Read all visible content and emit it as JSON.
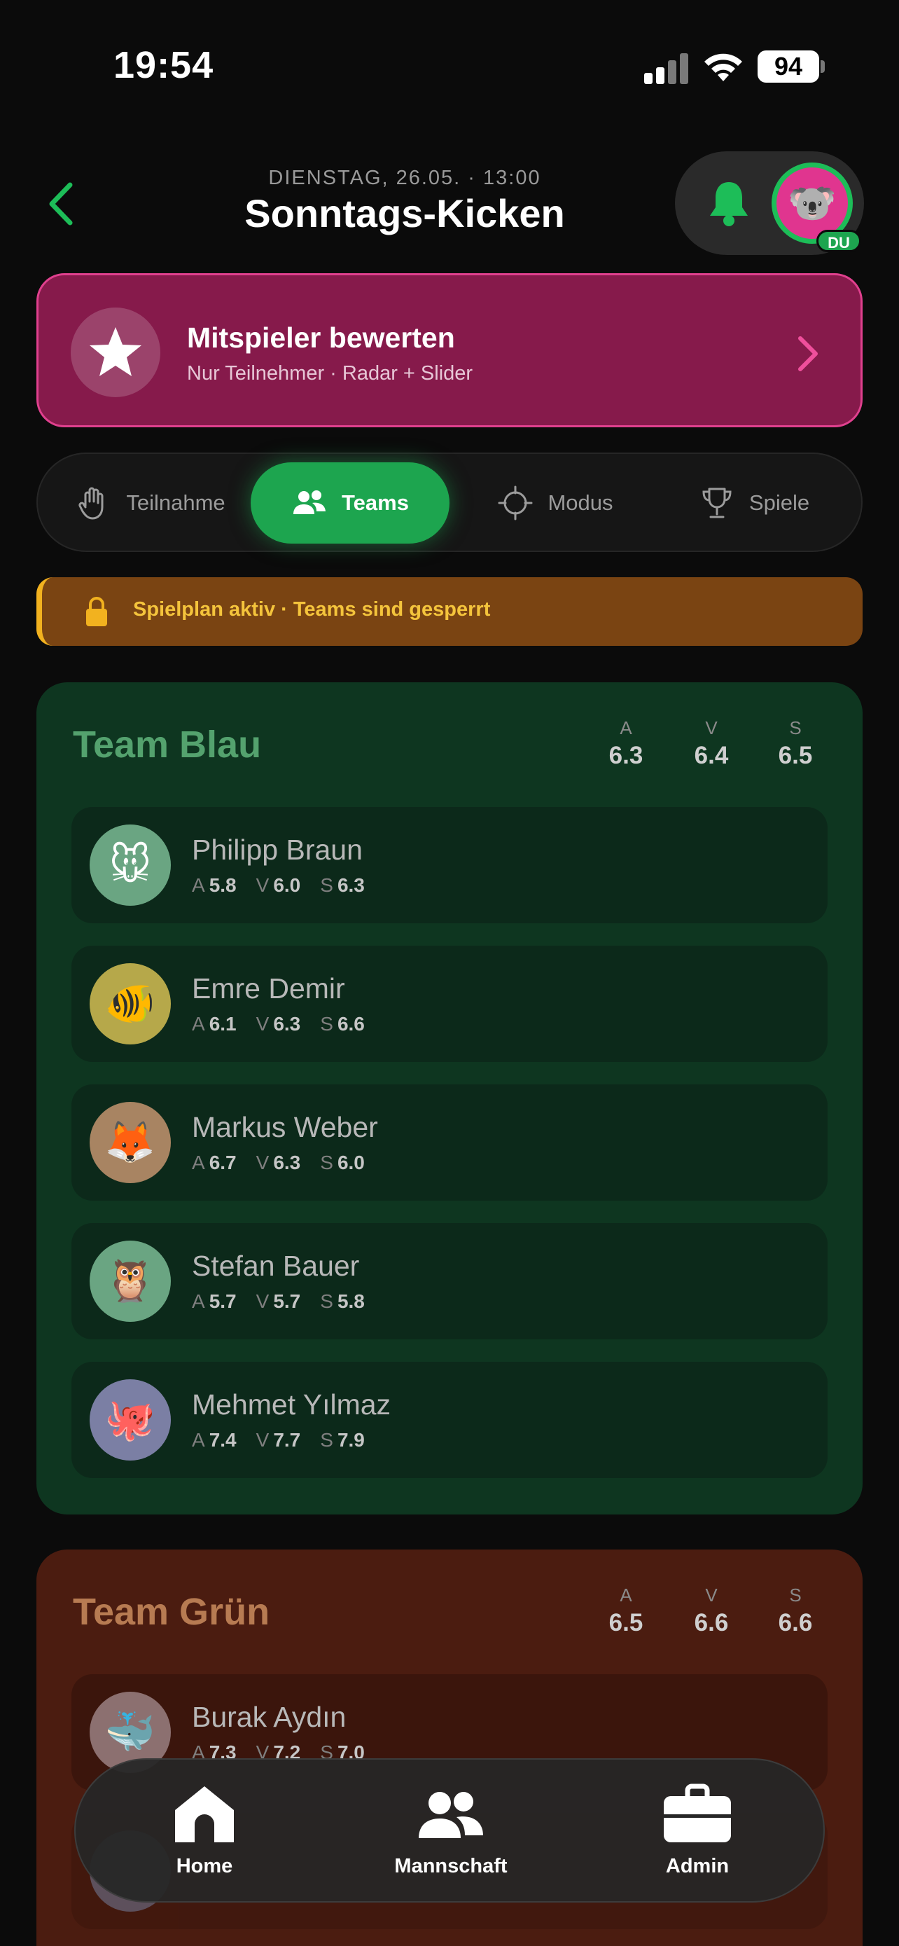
{
  "status_bar": {
    "time": "19:54",
    "battery": "94"
  },
  "header": {
    "datetime": "DIENSTAG, 26.05. · 13:00",
    "title": "Sonntags-Kicken",
    "avatar_emoji": "🐨",
    "avatar_badge": "DU"
  },
  "rating_banner": {
    "title": "Mitspieler bewerten",
    "subtitle": "Nur Teilnehmer · Radar + Slider"
  },
  "tabs": [
    {
      "label": "Teilnahme",
      "icon": "hand-icon",
      "active": false
    },
    {
      "label": "Teams",
      "icon": "users-icon",
      "active": true
    },
    {
      "label": "Modus",
      "icon": "crosshair-icon",
      "active": false
    },
    {
      "label": "Spiele",
      "icon": "trophy-icon",
      "active": false
    }
  ],
  "lock_banner": {
    "text": "Spielplan aktiv · Teams sind gesperrt"
  },
  "stat_keys": {
    "a": "A",
    "v": "V",
    "s": "S"
  },
  "teams": [
    {
      "name": "Team Blau",
      "stats": {
        "a": "6.3",
        "v": "6.4",
        "s": "6.5"
      },
      "players": [
        {
          "name": "Philipp Braun",
          "emoji": "🐭",
          "bg": "#6aa582",
          "a": "5.8",
          "v": "6.0",
          "s": "6.3"
        },
        {
          "name": "Emre Demir",
          "emoji": "🐠",
          "bg": "#b6a84a",
          "a": "6.1",
          "v": "6.3",
          "s": "6.6"
        },
        {
          "name": "Markus Weber",
          "emoji": "🦊",
          "bg": "#a88462",
          "a": "6.7",
          "v": "6.3",
          "s": "6.0"
        },
        {
          "name": "Stefan Bauer",
          "emoji": "🦉",
          "bg": "#6aa582",
          "a": "5.7",
          "v": "5.7",
          "s": "5.8"
        },
        {
          "name": "Mehmet Yılmaz",
          "emoji": "🐙",
          "bg": "#7b7fa4",
          "a": "7.4",
          "v": "7.7",
          "s": "7.9"
        }
      ]
    },
    {
      "name": "Team Grün",
      "stats": {
        "a": "6.5",
        "v": "6.6",
        "s": "6.6"
      },
      "players": [
        {
          "name": "Burak Aydın",
          "emoji": "🐳",
          "bg": "#8c7070",
          "a": "7.3",
          "v": "7.2",
          "s": "7.0"
        }
      ]
    }
  ],
  "bottom_nav": [
    {
      "label": "Home",
      "icon": "home-icon"
    },
    {
      "label": "Mannschaft",
      "icon": "team-icon"
    },
    {
      "label": "Admin",
      "icon": "briefcase-icon"
    }
  ]
}
